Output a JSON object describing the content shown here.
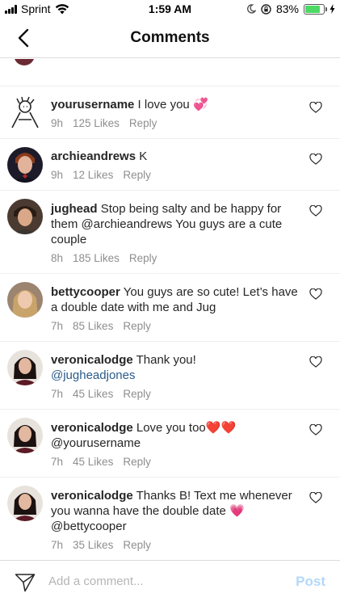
{
  "status_bar": {
    "carrier": "Sprint",
    "time": "1:59 AM",
    "battery": "83%",
    "battery_level": 0.83,
    "icons": [
      "signal-icon",
      "wifi-icon",
      "do-not-disturb-icon",
      "rotation-lock-icon",
      "battery-icon",
      "charging-icon"
    ]
  },
  "nav": {
    "title": "Comments",
    "back_icon": "chevron-left-icon"
  },
  "comments": [
    {
      "username": "yourusername",
      "text": "I love you",
      "emoji": "💞",
      "mention": "",
      "time": "9h",
      "likes": "125 Likes",
      "reply": "Reply"
    },
    {
      "username": "archieandrews",
      "text": "K",
      "emoji": "",
      "mention": "",
      "time": "9h",
      "likes": "12 Likes",
      "reply": "Reply"
    },
    {
      "username": "jughead",
      "text": "Stop being salty and be happy for them @archieandrews You guys are a cute couple",
      "emoji": "",
      "mention": "",
      "time": "8h",
      "likes": "185 Likes",
      "reply": "Reply"
    },
    {
      "username": "bettycooper",
      "text": "You guys are so cute! Let’s have a double date with me and Jug",
      "emoji": "",
      "mention": "",
      "time": "7h",
      "likes": "85 Likes",
      "reply": "Reply"
    },
    {
      "username": "veronicalodge",
      "text": "Thank you!",
      "emoji": "",
      "mention": "@jugheadjones",
      "time": "7h",
      "likes": "45 Likes",
      "reply": "Reply"
    },
    {
      "username": "veronicalodge",
      "text": "Love you too",
      "emoji": "❤️❤️",
      "mention": "@yourusername",
      "time": "7h",
      "likes": "45 Likes",
      "reply": "Reply"
    },
    {
      "username": "veronicalodge",
      "text": "Thanks B! Text me whenever you wanna have the double date",
      "emoji": "💗",
      "mention": "@bettycooper",
      "time": "7h",
      "likes": "35 Likes",
      "reply": "Reply"
    }
  ],
  "compose": {
    "placeholder": "Add a comment...",
    "post_label": "Post",
    "send_icon": "paper-plane-icon"
  },
  "colors": {
    "mention": "#2b5b8a",
    "meta": "#8e8e8e",
    "post_disabled": "#b3d8f9",
    "battery": "#4cd964"
  }
}
